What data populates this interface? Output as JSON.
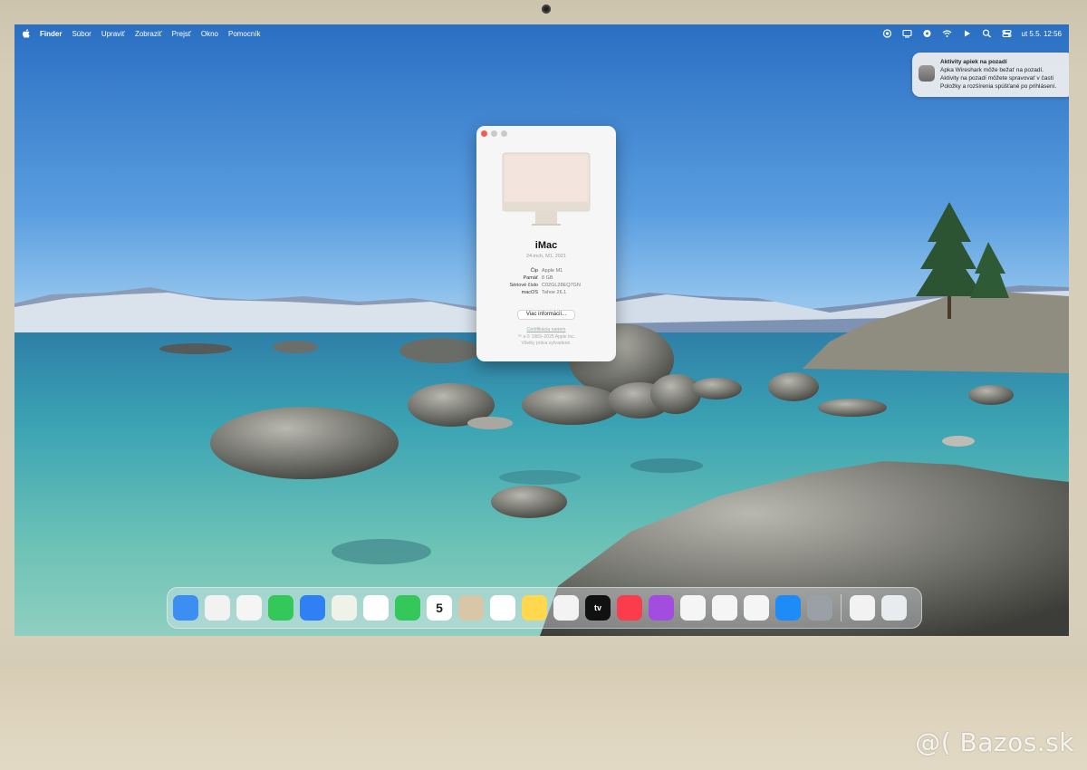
{
  "menubar": {
    "app_name": "Finder",
    "items": [
      "Súbor",
      "Upraviť",
      "Zobraziť",
      "Prejsť",
      "Okno",
      "Pomocník"
    ],
    "clock": "ut 5.5.  12:56",
    "status_icons": [
      "battery-icon",
      "screen-mirror-icon",
      "siri-icon",
      "wifi-icon",
      "play-icon",
      "search-icon",
      "control-center-icon"
    ]
  },
  "notification": {
    "title": "Aktivity apiek na pozadí",
    "line1": "Apka Wireshark môže bežať na pozadí.",
    "line2": "Aktivity na pozadí môžete spravovať v časti",
    "line3": "Položky a rozšírenia spúšťané po prihlásení."
  },
  "about_window": {
    "model": "iMac",
    "subtitle": "24-inch, M1, 2021",
    "specs": [
      {
        "key": "Čip",
        "value": "Apple M1"
      },
      {
        "key": "Pamäť",
        "value": "8 GB"
      },
      {
        "key": "Sériové číslo",
        "value": "C02GL28EQ7GN"
      },
      {
        "key": "macOS",
        "value": "Tahoe 26.1"
      }
    ],
    "more_button": "Viac informácií...",
    "certification_link": "Certifikácia nariem",
    "copyright_line1": "™ a © 1983–2025 Apple Inc.",
    "copyright_line2": "Všetky práva vyhradené."
  },
  "dock": {
    "items": [
      {
        "name": "finder-icon",
        "color": "#3d8ef2"
      },
      {
        "name": "launchpad-icon",
        "color": "#f2f2f2"
      },
      {
        "name": "safari-icon",
        "color": "#f5f5f5"
      },
      {
        "name": "messages-icon",
        "color": "#34c759"
      },
      {
        "name": "mail-icon",
        "color": "#2f7ff5"
      },
      {
        "name": "maps-icon",
        "color": "#eef2e8"
      },
      {
        "name": "photos-icon",
        "color": "#ffffff"
      },
      {
        "name": "facetime-icon",
        "color": "#34c759"
      },
      {
        "name": "calendar-icon",
        "color": "#ffffff",
        "label": "5"
      },
      {
        "name": "contacts-icon",
        "color": "#d8c6a8"
      },
      {
        "name": "reminders-icon",
        "color": "#ffffff"
      },
      {
        "name": "notes-icon",
        "color": "#ffd84d"
      },
      {
        "name": "freeform-icon",
        "color": "#f3f3f3"
      },
      {
        "name": "apple-tv-icon",
        "color": "#111111",
        "label": "tv"
      },
      {
        "name": "music-icon",
        "color": "#fa3c4c"
      },
      {
        "name": "podcasts-icon",
        "color": "#a24de0"
      },
      {
        "name": "keynote-icon",
        "color": "#f5f5f5"
      },
      {
        "name": "numbers-icon",
        "color": "#f5f5f5"
      },
      {
        "name": "pages-icon",
        "color": "#f5f5f5"
      },
      {
        "name": "app-store-icon",
        "color": "#1d8cf8"
      },
      {
        "name": "system-settings-icon",
        "color": "#9ba0a6"
      }
    ],
    "right_items": [
      {
        "name": "downloads-icon",
        "color": "#f2f2f2"
      },
      {
        "name": "trash-icon",
        "color": "#e9ecef"
      }
    ]
  },
  "watermark": "@( Bazos.sk"
}
